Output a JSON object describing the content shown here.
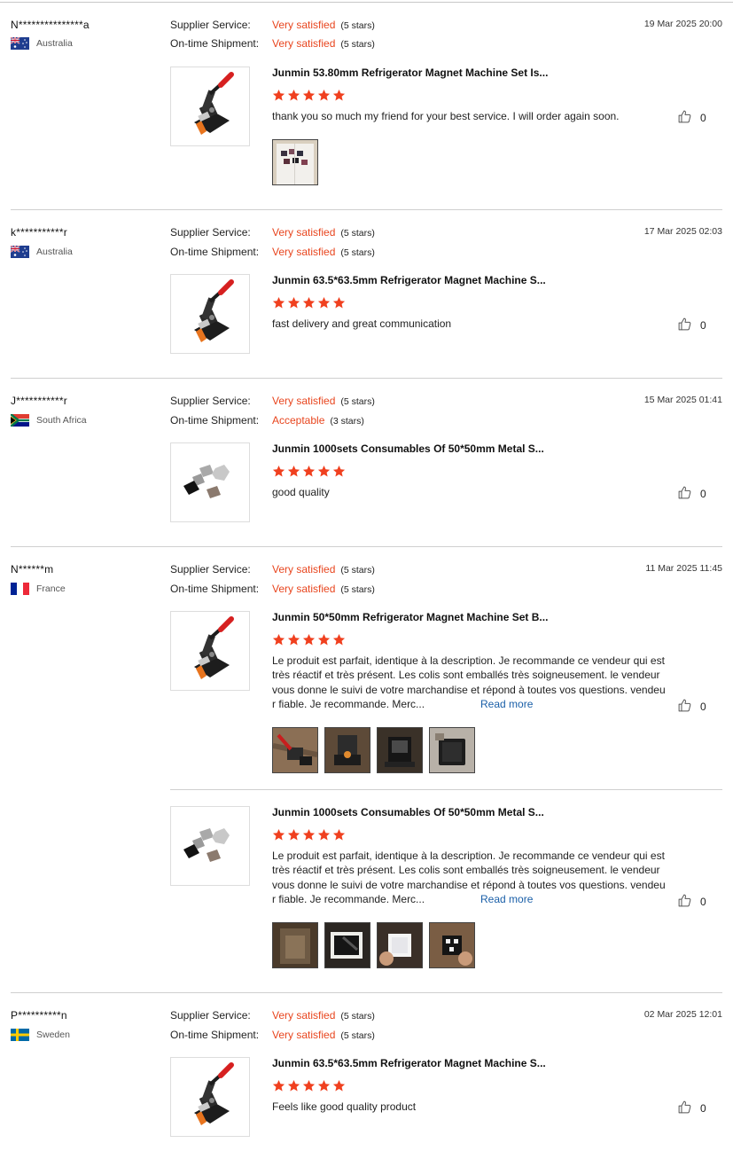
{
  "colors": {
    "accent": "#e8451e",
    "link": "#1a5fa8",
    "star": "#f0401f"
  },
  "labels": {
    "supplier_service": "Supplier Service:",
    "shipment": "On-time Shipment:",
    "read_more": "Read more"
  },
  "reviews": [
    {
      "buyer": "N***************a",
      "country": "Australia",
      "flag": "australia-flag-icon",
      "date": "19 Mar 2025 20:00",
      "supplier_rating": "Very satisfied",
      "supplier_stars": "(5 stars)",
      "shipment_rating": "Very satisfied",
      "shipment_stars": "(5 stars)",
      "products": [
        {
          "title": "Junmin 53.80mm Refrigerator Magnet Machine Set Is...",
          "thumb": "press-machine-image",
          "stars": 5,
          "text": "thank you so much my friend for your best service. I will order again soon.",
          "likes": "0",
          "photos": [
            "fridge-magnets-photo"
          ]
        }
      ]
    },
    {
      "buyer": "k***********r",
      "country": "Australia",
      "flag": "australia-flag-icon",
      "date": "17 Mar 2025 02:03",
      "supplier_rating": "Very satisfied",
      "supplier_stars": "(5 stars)",
      "shipment_rating": "Very satisfied",
      "shipment_stars": "(5 stars)",
      "products": [
        {
          "title": "Junmin 63.5*63.5mm Refrigerator Magnet Machine S...",
          "thumb": "press-machine-image",
          "stars": 5,
          "text": "fast delivery and great communication",
          "likes": "0",
          "photos": []
        }
      ]
    },
    {
      "buyer": "J***********r",
      "country": "South Africa",
      "flag": "south-africa-flag-icon",
      "date": "15 Mar 2025 01:41",
      "supplier_rating": "Very satisfied",
      "supplier_stars": "(5 stars)",
      "shipment_rating": "Acceptable",
      "shipment_stars": "(3 stars)",
      "products": [
        {
          "title": "Junmin 1000sets Consumables Of 50*50mm Metal S...",
          "thumb": "consumables-image",
          "stars": 5,
          "text": "good quality",
          "likes": "0",
          "photos": []
        }
      ]
    },
    {
      "buyer": "N******m",
      "country": "France",
      "flag": "france-flag-icon",
      "date": "11 Mar 2025 11:45",
      "supplier_rating": "Very satisfied",
      "supplier_stars": "(5 stars)",
      "shipment_rating": "Very satisfied",
      "shipment_stars": "(5 stars)",
      "products": [
        {
          "title": "Junmin 50*50mm Refrigerator Magnet Machine Set B...",
          "thumb": "press-machine-image",
          "stars": 5,
          "text_lines": [
            "Le produit est parfait, identique à la description. Je recommande ce vendeur qui est",
            "très réactif et très présent. Les colis sont emballés très soigneusement. le vendeur",
            "vous donne le suivi de votre marchandise et répond à toutes vos questions. vendeu",
            "r fiable. Je recommande. Merc..."
          ],
          "likes": "0",
          "photos": [
            "machine-photo-1",
            "machine-photo-2",
            "machine-photo-3",
            "machine-photo-4"
          ]
        },
        {
          "title": "Junmin 1000sets Consumables Of 50*50mm Metal S...",
          "thumb": "consumables-image",
          "stars": 5,
          "text_lines": [
            "Le produit est parfait, identique à la description. Je recommande ce vendeur qui est",
            "très réactif et très présent. Les colis sont emballés très soigneusement. le vendeur",
            "vous donne le suivi de votre marchandise et répond à toutes vos questions. vendeu",
            "r fiable. Je recommande. Merc..."
          ],
          "likes": "0",
          "photos": [
            "package-photo-1",
            "package-photo-2",
            "package-photo-3",
            "package-photo-4"
          ]
        }
      ]
    },
    {
      "buyer": "P**********n",
      "country": "Sweden",
      "flag": "sweden-flag-icon",
      "date": "02 Mar 2025 12:01",
      "supplier_rating": "Very satisfied",
      "supplier_stars": "(5 stars)",
      "shipment_rating": "Very satisfied",
      "shipment_stars": "(5 stars)",
      "products": [
        {
          "title": "Junmin 63.5*63.5mm Refrigerator Magnet Machine S...",
          "thumb": "press-machine-image",
          "stars": 5,
          "text": "Feels like good quality product",
          "likes": "0",
          "photos": []
        }
      ]
    }
  ]
}
